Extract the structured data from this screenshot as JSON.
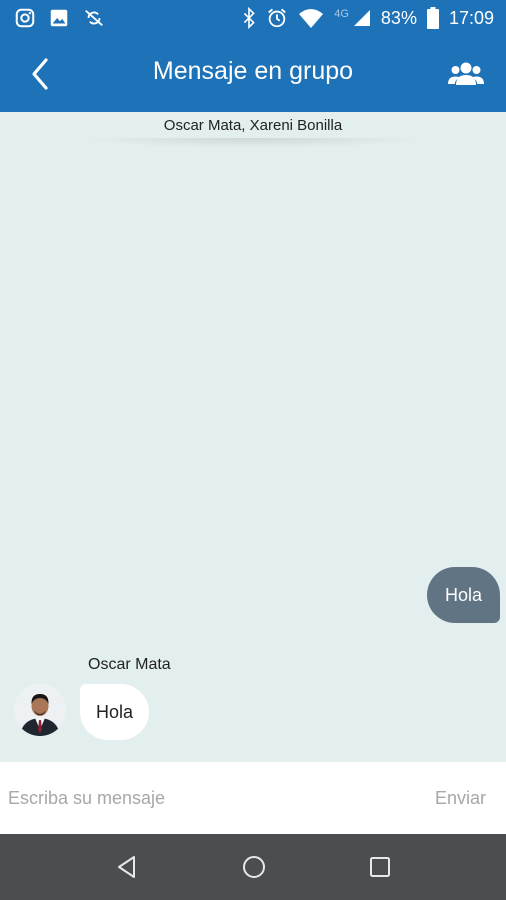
{
  "status_bar": {
    "network": "4G",
    "battery": "83%",
    "time": "17:09",
    "left_icons": [
      "instagram-icon",
      "image-icon",
      "sync-off-icon"
    ],
    "right_icons": [
      "bluetooth-icon",
      "alarm-icon",
      "wifi-icon",
      "signal-icon",
      "battery-icon"
    ]
  },
  "header": {
    "title": "Mensaje en grupo",
    "back_icon": "chevron-left-icon",
    "group_icon": "group-icon",
    "color": "#1d72b8"
  },
  "chat": {
    "participants": "Oscar Mata, Xareni Bonilla",
    "background": "#e3efef",
    "messages": [
      {
        "direction": "outgoing",
        "text": "Hola",
        "bubble_color": "#607484"
      },
      {
        "direction": "incoming",
        "sender": "Oscar Mata",
        "text": "Hola",
        "bubble_color": "#ffffff"
      }
    ]
  },
  "composer": {
    "placeholder": "Escriba su mensaje",
    "value": "",
    "send_label": "Enviar"
  },
  "nav_bar": {
    "icons": [
      "back-triangle-icon",
      "home-circle-icon",
      "recents-square-icon"
    ],
    "color": "#4a4e51"
  }
}
